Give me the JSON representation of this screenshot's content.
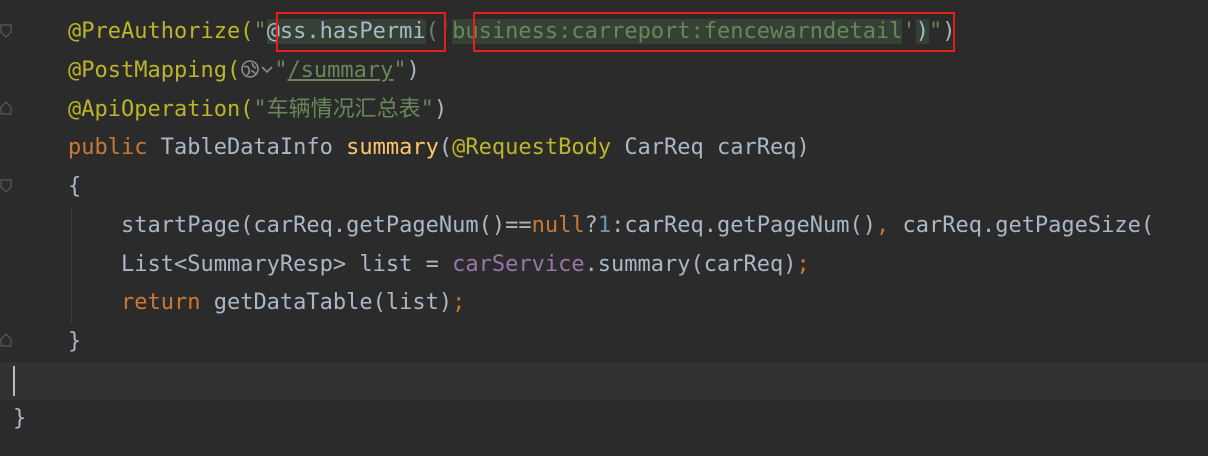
{
  "editor": {
    "lines": [
      [
        {
          "t": "@PreAuthorize(",
          "c": "ann"
        },
        {
          "t": "\"",
          "c": "str"
        },
        {
          "t": "@ss.hasPermi",
          "c": "plain",
          "hl": true
        },
        {
          "t": "('",
          "c": "str"
        },
        {
          "t": "business:carreport:fencewarndetail",
          "c": "str",
          "hl": true
        },
        {
          "t": "'",
          "c": "str"
        },
        {
          "t": ")",
          "c": "plain",
          "hl": true
        },
        {
          "t": "\"",
          "c": "str"
        },
        {
          "t": ")",
          "c": "plain"
        }
      ],
      [
        {
          "t": "@PostMapping(",
          "c": "ann"
        },
        {
          "t": "ICON",
          "c": "icon"
        },
        {
          "t": "\"",
          "c": "str"
        },
        {
          "t": "/summary",
          "c": "link"
        },
        {
          "t": "\"",
          "c": "str"
        },
        {
          "t": ")",
          "c": "plain"
        }
      ],
      [
        {
          "t": "@ApiOperation(",
          "c": "ann"
        },
        {
          "t": "\"车辆情况汇总表\"",
          "c": "str"
        },
        {
          "t": ")",
          "c": "plain"
        }
      ],
      [
        {
          "t": "public ",
          "c": "kw"
        },
        {
          "t": "TableDataInfo ",
          "c": "plain"
        },
        {
          "t": "summary",
          "c": "fn"
        },
        {
          "t": "(",
          "c": "plain"
        },
        {
          "t": "@RequestBody ",
          "c": "ann"
        },
        {
          "t": "CarReq carReq)",
          "c": "plain"
        }
      ],
      [
        {
          "t": "{",
          "c": "plain"
        }
      ],
      [
        {
          "t": "    startPage(carReq.getPageNum()==",
          "c": "plain"
        },
        {
          "t": "null",
          "c": "kw"
        },
        {
          "t": "?",
          "c": "plain"
        },
        {
          "t": "1",
          "c": "num"
        },
        {
          "t": ":carReq.getPageNum()",
          "c": "plain"
        },
        {
          "t": ", ",
          "c": "kw"
        },
        {
          "t": "carReq.getPageSize(",
          "c": "plain"
        }
      ],
      [
        {
          "t": "    List<SummaryResp> list = ",
          "c": "plain"
        },
        {
          "t": "carService",
          "c": "field"
        },
        {
          "t": ".summary(carReq)",
          "c": "plain"
        },
        {
          "t": ";",
          "c": "kw"
        }
      ],
      [
        {
          "t": "    ",
          "c": "plain"
        },
        {
          "t": "return ",
          "c": "kw"
        },
        {
          "t": "getDataTable(list)",
          "c": "plain"
        },
        {
          "t": ";",
          "c": "kw"
        }
      ],
      [
        {
          "t": "}",
          "c": "plain"
        }
      ],
      [],
      [
        {
          "t": "}",
          "c": "plain"
        }
      ]
    ],
    "colors": {
      "background": "#2b2b2b",
      "annotation": "#bbb529",
      "string": "#6a8759",
      "keyword": "#cc7832",
      "function": "#ffc66d",
      "number": "#6897bb",
      "field": "#9876aa",
      "text": "#a9b7c6",
      "highlight_box": "#e3201b"
    },
    "icons": [
      "globe-icon",
      "chevron-down-icon",
      "fold-marker-icon"
    ]
  }
}
